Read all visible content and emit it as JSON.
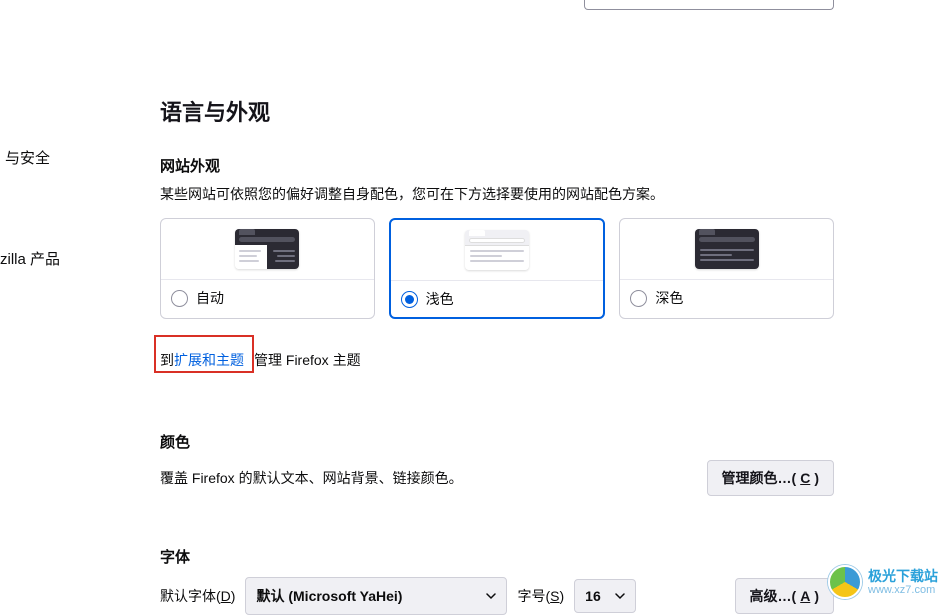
{
  "sidebar": {
    "items": [
      {
        "label": ""
      },
      {
        "label": ""
      },
      {
        "label": ""
      },
      {
        "label": "与安全"
      },
      {
        "label": ""
      },
      {
        "label": "zilla 产品"
      }
    ]
  },
  "section": {
    "title": "语言与外观",
    "appearance": {
      "heading": "网站外观",
      "desc": "某些网站可依照您的偏好调整自身配色，您可在下方选择要使用的网站配色方案。",
      "options": {
        "auto": "自动",
        "light": "浅色",
        "dark": "深色"
      },
      "ext_prefix": "到",
      "ext_link": "扩展和主题",
      "ext_suffix": "管理 Firefox 主题"
    },
    "colors": {
      "heading": "颜色",
      "desc": "覆盖 Firefox 的默认文本、网站背景、链接颜色。",
      "manage_btn": "管理颜色…(",
      "manage_key": "C",
      "manage_btn_end": ")"
    },
    "fonts": {
      "heading": "字体",
      "default_font_label_pre": "默认字体(",
      "default_font_key": "D",
      "default_font_label_post": ")",
      "font_value": "默认  (Microsoft YaHei)",
      "size_label_pre": "字号(",
      "size_key": "S",
      "size_label_post": ")",
      "size_value": "16",
      "advanced_btn": "高级…(",
      "advanced_key": "A",
      "advanced_btn_end": ")"
    }
  },
  "watermark": {
    "line1": "极光下载站",
    "line2": "www.xz7.com"
  }
}
